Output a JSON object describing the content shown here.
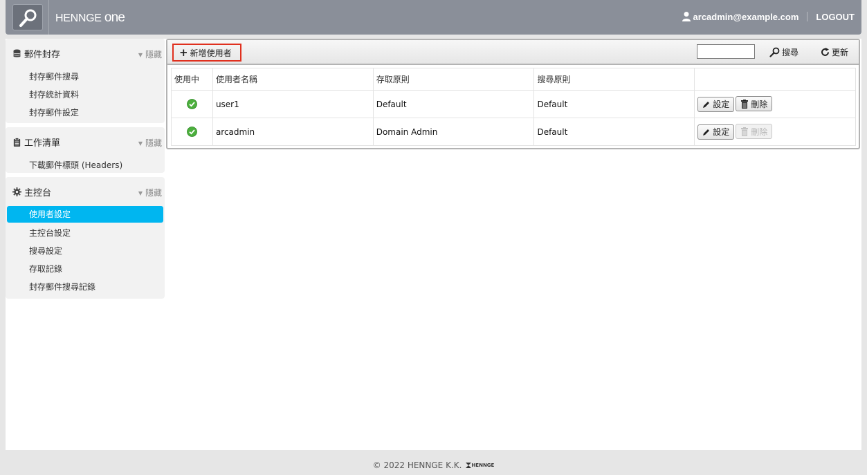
{
  "header": {
    "brand": "HENNGE",
    "brand_suffix": "one",
    "user_email": "arcadmin@example.com",
    "logout_label": "LOGOUT"
  },
  "sidebar": {
    "hide_label": "隱藏",
    "sections": [
      {
        "title": "郵件封存",
        "icon": "database-icon",
        "items": [
          {
            "label": "封存郵件搜尋"
          },
          {
            "label": "封存統計資料"
          },
          {
            "label": "封存郵件設定"
          }
        ]
      },
      {
        "title": "工作清單",
        "icon": "clipboard-icon",
        "items": [
          {
            "label": "下載郵件標頭 (Headers)"
          }
        ]
      },
      {
        "title": "主控台",
        "icon": "gear-icon",
        "items": [
          {
            "label": "使用者設定",
            "active": true
          },
          {
            "label": "主控台設定"
          },
          {
            "label": "搜尋設定"
          },
          {
            "label": "存取記錄"
          },
          {
            "label": "封存郵件搜尋記錄"
          }
        ]
      }
    ]
  },
  "toolbar": {
    "add_user_label": "新增使用者",
    "search_value": "",
    "search_label": "搜尋",
    "refresh_label": "更新"
  },
  "table": {
    "columns": [
      "使用中",
      "使用者名稱",
      "存取原則",
      "搜尋原則",
      ""
    ],
    "rows": [
      {
        "active": true,
        "username": "user1",
        "access_policy": "Default",
        "search_policy": "Default",
        "delete_enabled": true
      },
      {
        "active": true,
        "username": "arcadmin",
        "access_policy": "Domain Admin",
        "search_policy": "Default",
        "delete_enabled": false
      }
    ],
    "edit_label": "設定",
    "delete_label": "刪除"
  },
  "colors": {
    "header_bg": "#8a8f99",
    "active_item": "#00b6f0",
    "highlight_border": "#e0301e",
    "check_green": "#4caf3d"
  },
  "footer": {
    "copyright": "© 2022 HENNGE K.K.",
    "logo_text": "HENNGE"
  }
}
